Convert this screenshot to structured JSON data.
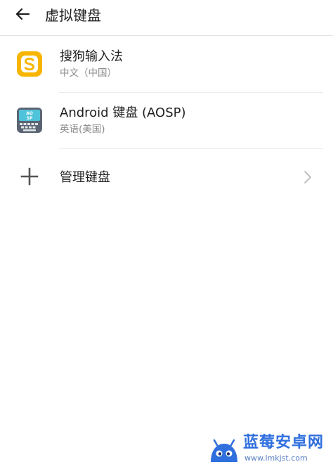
{
  "header": {
    "title": "虚拟键盘",
    "back_icon": "arrow-left-icon"
  },
  "keyboards": [
    {
      "title": "搜狗输入法",
      "subtitle": "中文（中国）",
      "icon": "sogou-icon",
      "icon_color": "#f7b500"
    },
    {
      "title": "Android 键盘 (AOSP)",
      "subtitle": "英语(美国)",
      "icon": "aosp-keyboard-icon",
      "icon_color": "#4a5568"
    }
  ],
  "manage": {
    "label": "管理键盘",
    "icon": "plus-icon",
    "chevron_icon": "chevron-right-icon"
  },
  "watermark": {
    "name": "蓝莓安卓网",
    "url": "www.lmkjst.com",
    "brand_color": "#2f6fde"
  }
}
